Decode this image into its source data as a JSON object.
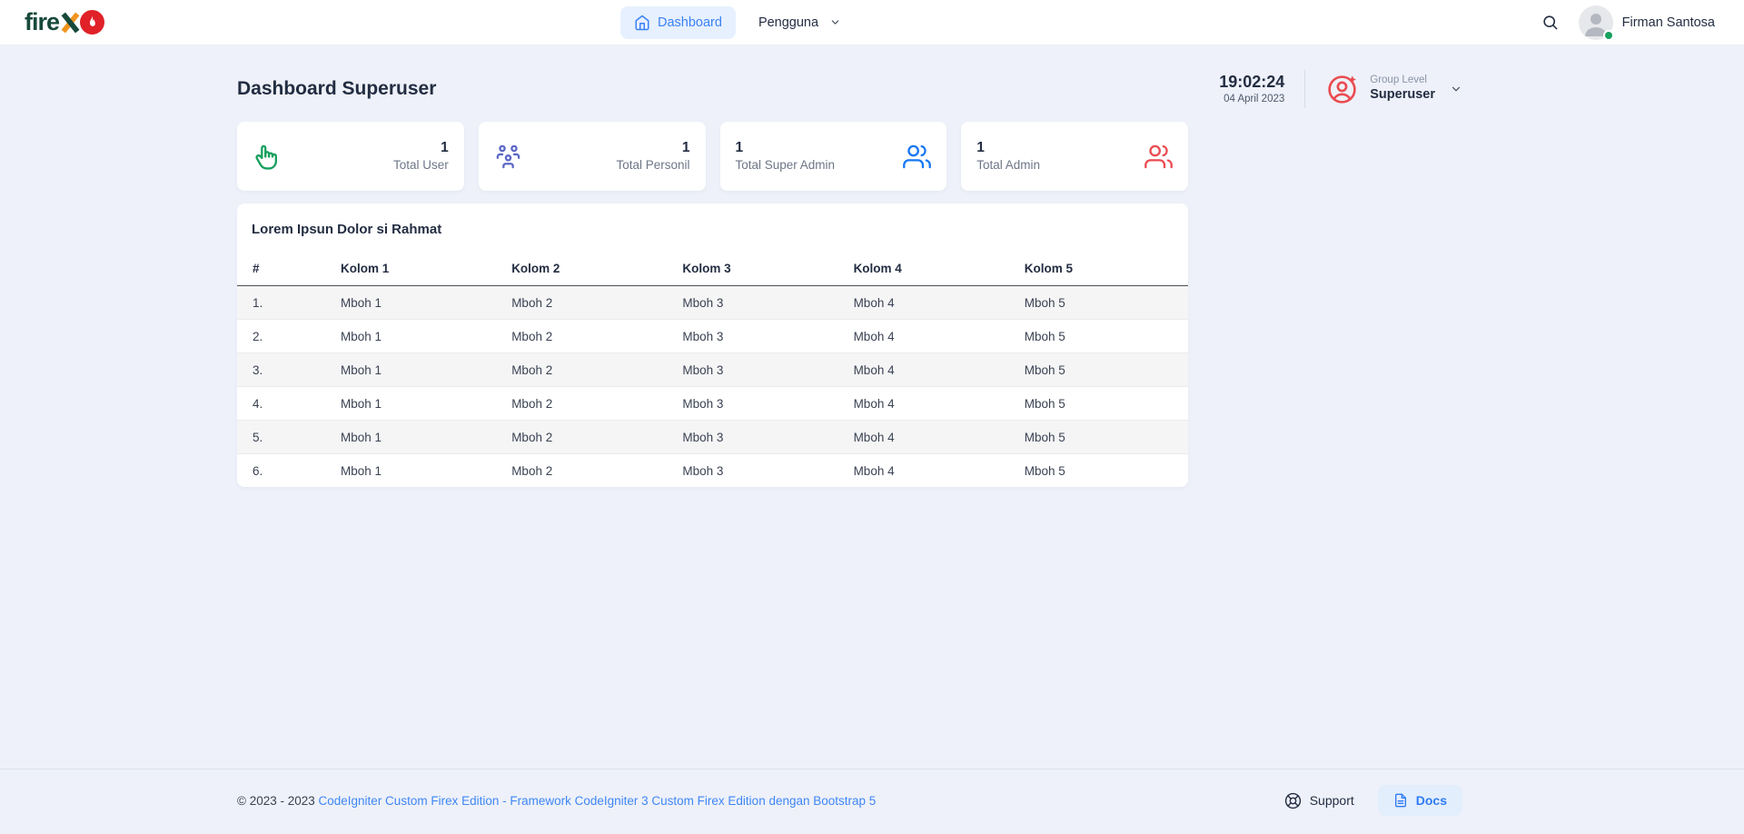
{
  "navbar": {
    "logo": {
      "text": "fireX",
      "text_fire": "fire"
    },
    "items": [
      {
        "label": "Dashboard",
        "active": true
      },
      {
        "label": "Pengguna",
        "active": false
      }
    ],
    "user": {
      "name": "Firman Santosa",
      "status": "online"
    }
  },
  "header": {
    "title": "Dashboard Superuser",
    "clock": {
      "time": "19:02:24",
      "date": "04 April 2023"
    },
    "group": {
      "label": "Group Level",
      "value": "Superuser"
    }
  },
  "stats": [
    {
      "value": "1",
      "label": "Total User",
      "icon": "hand-finger-icon",
      "color": "#17a05e"
    },
    {
      "value": "1",
      "label": "Total Personil",
      "icon": "users-group-icon",
      "color": "#5b67c7"
    },
    {
      "value": "1",
      "label": "Total Super Admin",
      "icon": "users-icon",
      "color": "#1677f2"
    },
    {
      "value": "1",
      "label": "Total Admin",
      "icon": "users-icon",
      "color": "#ea4b50"
    }
  ],
  "table_card": {
    "title": "Lorem Ipsun Dolor si Rahmat",
    "columns": [
      "#",
      "Kolom 1",
      "Kolom 2",
      "Kolom 3",
      "Kolom 4",
      "Kolom 5"
    ],
    "rows": [
      [
        "1.",
        "Mboh 1",
        "Mboh 2",
        "Mboh 3",
        "Mboh 4",
        "Mboh 5"
      ],
      [
        "2.",
        "Mboh 1",
        "Mboh 2",
        "Mboh 3",
        "Mboh 4",
        "Mboh 5"
      ],
      [
        "3.",
        "Mboh 1",
        "Mboh 2",
        "Mboh 3",
        "Mboh 4",
        "Mboh 5"
      ],
      [
        "4.",
        "Mboh 1",
        "Mboh 2",
        "Mboh 3",
        "Mboh 4",
        "Mboh 5"
      ],
      [
        "5.",
        "Mboh 1",
        "Mboh 2",
        "Mboh 3",
        "Mboh 4",
        "Mboh 5"
      ],
      [
        "6.",
        "Mboh 1",
        "Mboh 2",
        "Mboh 3",
        "Mboh 4",
        "Mboh 5"
      ]
    ]
  },
  "footer": {
    "copyright": "© 2023 - 2023 ",
    "link": "CodeIgniter Custom Firex Edition - Framework CodeIgniter 3 Custom Firex Edition dengan Bootstrap 5",
    "support": "Support",
    "docs": "Docs"
  },
  "colors": {
    "background": "#eef1f9",
    "navbar": "#ffffff",
    "active_nav_bg": "#e7f0fe",
    "active_nav_text": "#3b82f6",
    "heading_text": "#232d42",
    "muted_text": "#8a92a6",
    "green": "#17a05e",
    "indigo": "#5b67c7",
    "blue": "#1677f2",
    "red": "#ea4b50",
    "link_blue": "#3f86f8",
    "docs_button_bg": "#e3eefd",
    "logo_green": "#17493b",
    "logo_orange": "#f0941d",
    "logo_red": "#e02128"
  }
}
